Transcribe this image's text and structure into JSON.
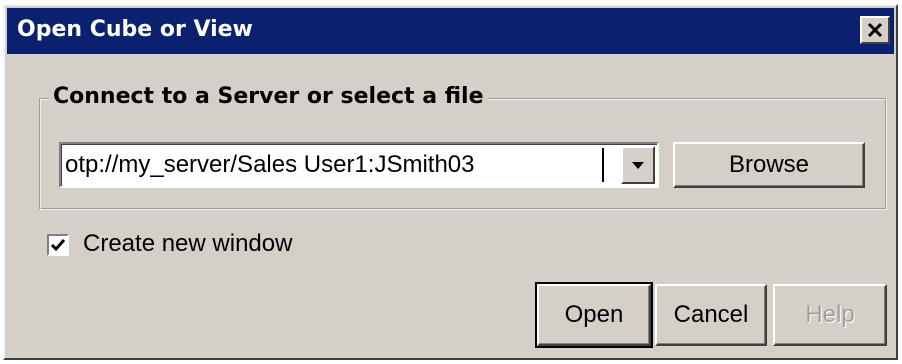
{
  "dialog": {
    "title": "Open Cube or View",
    "close_icon": "close-icon"
  },
  "connect_group": {
    "legend": "Connect to a Server or select a file",
    "combo": {
      "value": "otp://my_server/Sales User1:JSmith03",
      "dropdown_icon": "chevron-down-icon"
    },
    "browse_label": "Browse"
  },
  "options": {
    "create_new_window": {
      "label": "Create new window",
      "checked": true,
      "check_icon": "checkmark-icon"
    }
  },
  "buttons": {
    "open_label": "Open",
    "cancel_label": "Cancel",
    "help_label": "Help",
    "help_enabled": false
  },
  "colors": {
    "titlebar": "#0b2170",
    "dialog_face": "#d4d0c8"
  }
}
